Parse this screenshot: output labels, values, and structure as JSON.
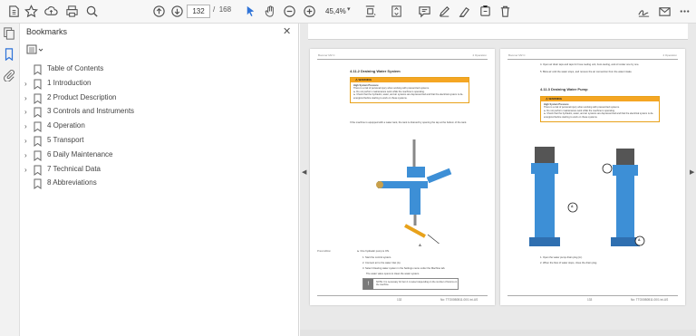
{
  "toolbar": {
    "page_current": "132",
    "page_total": "168",
    "page_sep": "/",
    "zoom": "45,4%"
  },
  "bookmarks": {
    "title": "Bookmarks",
    "close_glyph": "✕",
    "items": [
      {
        "label": "Table of Contents",
        "expandable": false
      },
      {
        "label": "1 Introduction",
        "expandable": true
      },
      {
        "label": "2 Product Description",
        "expandable": true
      },
      {
        "label": "3 Controls and Instruments",
        "expandable": true
      },
      {
        "label": "4 Operation",
        "expandable": true
      },
      {
        "label": "5 Transport",
        "expandable": true
      },
      {
        "label": "6 Daily Maintenance",
        "expandable": true
      },
      {
        "label": "7 Technical Data",
        "expandable": true
      },
      {
        "label": "8 Abbreviations",
        "expandable": false
      }
    ]
  },
  "page_left": {
    "header_left": "Boomer M2 C",
    "header_right": "4 Operation",
    "section_title": "4.11.2 Draining Water System",
    "warning_label": "WARNING",
    "warning_title": "High System Pressure",
    "warning_lines": [
      "There is a risk of personal injury when working with pressurized systems.",
      "► Do not perform maintenance work while the machine is operating.",
      "► Check that the hydraulic, water, and air systems are depressurized and that the electrical system is de-energized before starting to work on these systems."
    ],
    "intro": "If the machine is equipped with a water tank, the tank is drained by opening the tap at the bottom of the tank.",
    "callout": "A",
    "precondition_label": "Precondition",
    "precondition": "► One hydraulic pump is ON.",
    "steps": [
      "1.  Start the control system.",
      "2.  Connect air to the water inlet (A).",
      "3.  Select Clearing water system in the Settings menu under the Machine tab.",
      "The water valve opens to clean the water system."
    ],
    "notes": [
      "NOTE: It is necessary for Item 1 to select depending on the number of booms on the machine.",
      "NOTE: Never use the drilling hand to open the water valves as the water pump can then start and run dry, causing it to break down."
    ],
    "footer_left": "132",
    "footer_right": "No: TTO00B0511.00/1 ini-US"
  },
  "page_right": {
    "header_left": "Boomer M2 C",
    "header_right": "4 Operation",
    "steps_top": [
      "4.  Open air drain taps and taps for hose reeling unit, boot-reeling, and oil cooler one by one.",
      "5.  Blow air until the water stops, and remove the air connection from the water intake."
    ],
    "section_title": "4.11.3 Draining Water Pump",
    "warning_label": "WARNING",
    "warning_title": "High System Pressure",
    "warning_lines": [
      "There is a risk of personal injury when working with pressurized systems.",
      "► Do not perform maintenance work while the machine is operating.",
      "► Check that the hydraulic, water, and air systems are depressurized and that the electrical system is de-energized before starting to work on these systems."
    ],
    "callout_a": "A",
    "callout_b": "A",
    "steps_bottom": [
      "1.  Open the water pump drain plug (A).",
      "2.  When the flow of water stops, close the drain plug."
    ],
    "footer_left": "133",
    "footer_right": "No: TTO00B0511.00/1 ini-US"
  },
  "colors": {
    "accent_blue": "#2f73d8",
    "warning_orange": "#f5a623",
    "pump_blue": "#3d8fd6"
  }
}
